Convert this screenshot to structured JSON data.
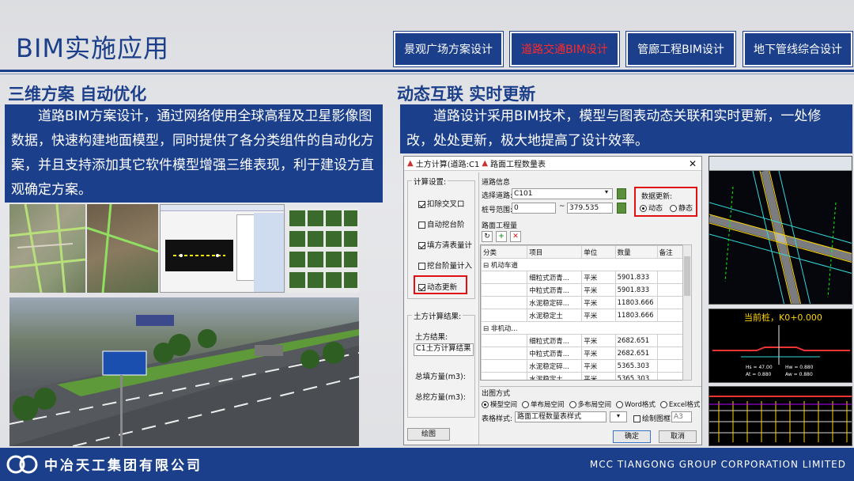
{
  "header": {
    "title": "BIM实施应用",
    "tabs": [
      {
        "label": "景观广场方案设计",
        "active": false
      },
      {
        "label": "道路交通BIM设计",
        "active": true
      },
      {
        "label": "管廊工程BIM设计",
        "active": false
      },
      {
        "label": "地下管线综合设计",
        "active": false
      }
    ]
  },
  "left": {
    "heading": "三维方案 自动优化",
    "text": "　　道路BIM方案设计，通过网络使用全球高程及卫星影像图数据，快速构建地面模型，同时提供了各分类组件的自动化方案，并且支持添加其它软件模型增强三维表现，利于建设方直观确定方案。"
  },
  "right": {
    "heading": "动态互联 实时更新",
    "text": "　　道路设计采用BIM技术，模型与图表动态关联和实时更新，一处修改，处处更新，极大地提高了设计效率。"
  },
  "dialog1": {
    "title": "土方计算(道路:C1",
    "calc_settings": "计算设置:",
    "checks": [
      {
        "label": "扣除交叉口",
        "checked": true
      },
      {
        "label": "自动挖台阶",
        "checked": false
      },
      {
        "label": "填方清表量计",
        "checked": true
      },
      {
        "label": "挖台阶量计入",
        "checked": false
      },
      {
        "label": "动态更新",
        "checked": true
      }
    ],
    "result_group": "土方计算结果:",
    "result_label": "土方结果:",
    "result_value": "C1土方计算结果",
    "fill_label": "总填方量(m3):",
    "cut_label": "总挖方量(m3):",
    "draw_btn": "绘图"
  },
  "dialog2": {
    "title": "路面工程数量表",
    "road_info": "道路信息",
    "select_road_label": "选择道路:",
    "select_road_value": "C101",
    "station_label": "桩号范围:",
    "station_from": "0",
    "station_to": "379.535",
    "tilde": "~",
    "data_update_label": "数据更新:",
    "radio_dynamic": "动态",
    "radio_static": "静态",
    "qty_group": "路面工程量",
    "columns": [
      "分类",
      "项目",
      "单位",
      "数量",
      "备注"
    ],
    "groups": [
      {
        "name": "机动车道",
        "rows": [
          {
            "item": "细粒式沥青...",
            "unit": "平米",
            "qty": "5901.833"
          },
          {
            "item": "中粒式沥青...",
            "unit": "平米",
            "qty": "5901.833"
          },
          {
            "item": "水泥稳定碎...",
            "unit": "平米",
            "qty": "11803.666"
          },
          {
            "item": "水泥稳定土",
            "unit": "平米",
            "qty": "11803.666"
          }
        ]
      },
      {
        "name": "非机动...",
        "rows": [
          {
            "item": "细粒式沥青...",
            "unit": "平米",
            "qty": "2682.651"
          },
          {
            "item": "中粒式沥青...",
            "unit": "平米",
            "qty": "2682.651"
          },
          {
            "item": "水泥稳定碎...",
            "unit": "平米",
            "qty": "5365.303"
          },
          {
            "item": "水泥稳定土",
            "unit": "平米",
            "qty": "5365.303"
          }
        ]
      }
    ],
    "output_group": "出图方式",
    "out_options": [
      {
        "label": "模型空间",
        "selected": true
      },
      {
        "label": "单布局空间",
        "selected": false
      },
      {
        "label": "多布局空间",
        "selected": false
      },
      {
        "label": "Word格式",
        "selected": false
      },
      {
        "label": "Excel格式",
        "selected": false
      }
    ],
    "table_style_label": "表格样式:",
    "table_style_value": "路面工程数量表样式",
    "draw_frame_label": "绘制图框",
    "paper": "A3",
    "ok_btn": "确定",
    "cancel_btn": "取消"
  },
  "section_view": {
    "label": "当前桩，K0+0.000",
    "vals": [
      "Hs = 47.00",
      "Hw = 0.880",
      "At = 0.880",
      "Aw = 0.880"
    ]
  },
  "footer": {
    "company_cn": "中冶天工集团有限公司",
    "company_en": "MCC TIANGONG GROUP CORPORATION LIMITED"
  },
  "colors": {
    "brand": "#1b3f8a",
    "active_tab": "#ff2a2a",
    "highlight": "#e01010"
  }
}
